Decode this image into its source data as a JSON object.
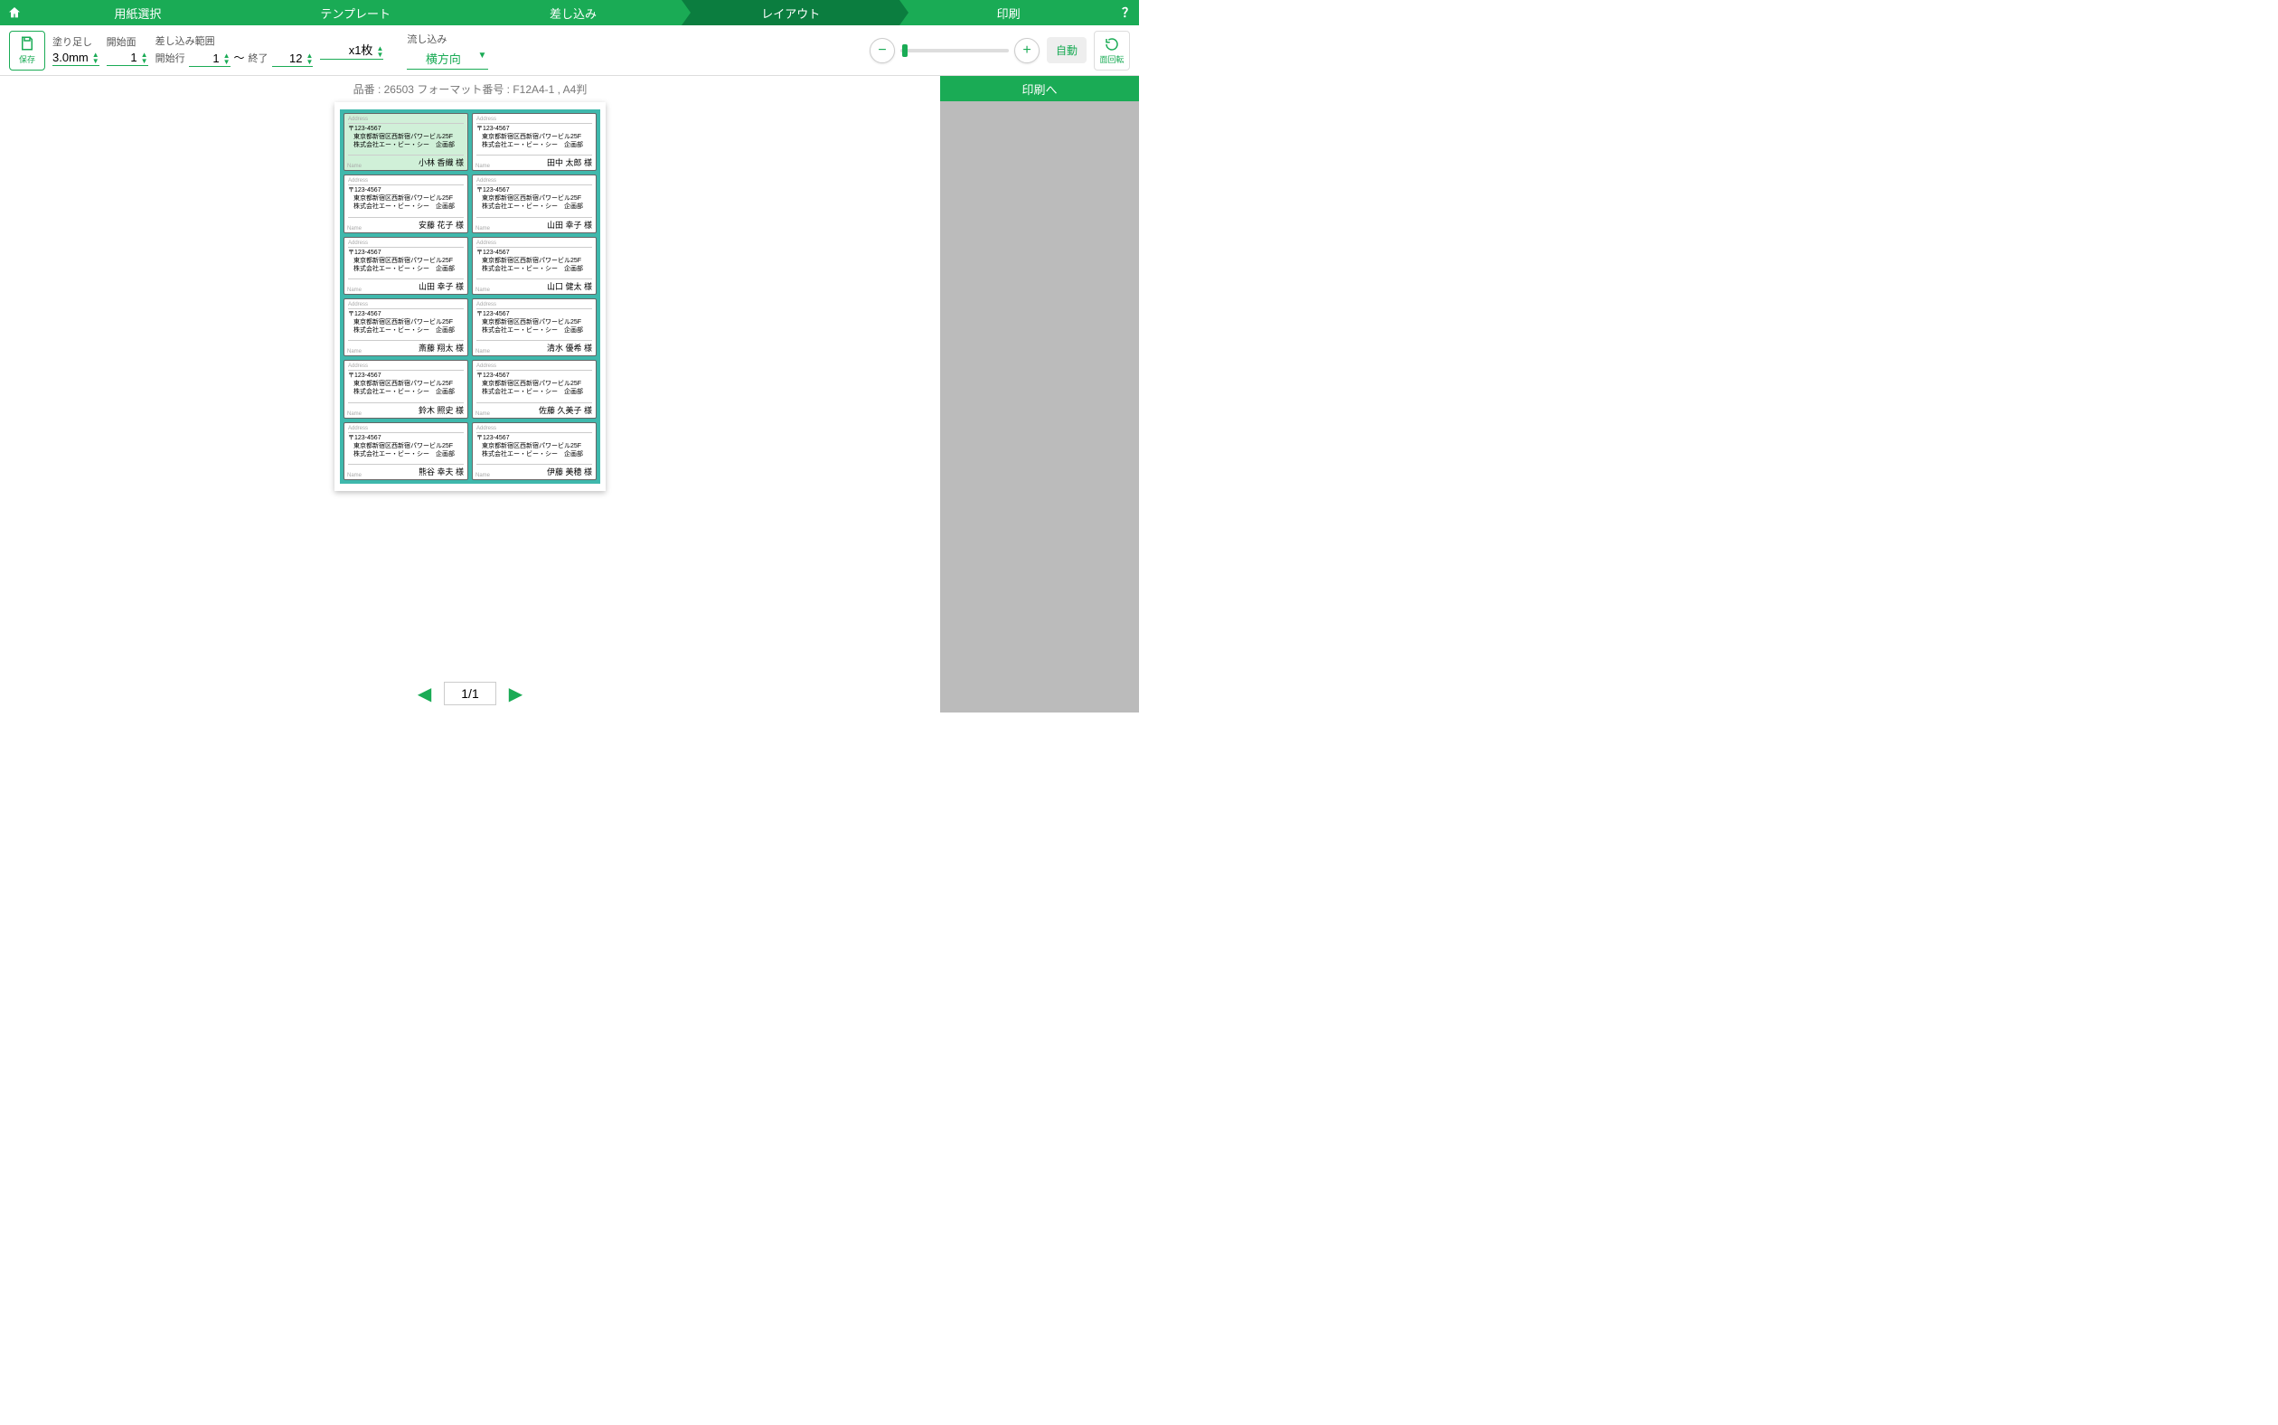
{
  "nav": {
    "steps": [
      "用紙選択",
      "テンプレート",
      "差し込み",
      "レイアウト",
      "印刷"
    ],
    "activeIndex": 3,
    "help": "？"
  },
  "toolbar": {
    "save_label": "保存",
    "bleed": {
      "label": "塗り足し",
      "value": "3.0mm"
    },
    "start_face": {
      "label": "開始面",
      "value": "1"
    },
    "merge_range": {
      "label": "差し込み範囲",
      "start_label": "開始行",
      "start": "1",
      "tilde": "〜",
      "end_label": "終了",
      "end": "12"
    },
    "copies": {
      "value": "x1枚"
    },
    "flow": {
      "label": "流し込み",
      "value": "横方向"
    },
    "auto": "自動",
    "rotate": "面回転"
  },
  "format_info": "品番 : 26503 フォーマット番号 : F12A4-1 , A4判",
  "common": {
    "zip": "〒123-4567",
    "addr1": "東京都新宿区西新宿パワービル25F",
    "addr2": "株式会社エー・ビー・シー　企画部",
    "addr_hdr": "Address",
    "name_hdr": "Name"
  },
  "labels": [
    {
      "name": "小林 香織 様",
      "selected": true
    },
    {
      "name": "田中 太郎 様"
    },
    {
      "name": "安藤 花子 様"
    },
    {
      "name": "山田 幸子 様"
    },
    {
      "name": "山田 幸子 様"
    },
    {
      "name": "山口 健太 様"
    },
    {
      "name": "斎藤 翔太 様"
    },
    {
      "name": "清水 優希 様"
    },
    {
      "name": "鈴木 照史 様"
    },
    {
      "name": "佐藤 久美子 様"
    },
    {
      "name": "熊谷 幸夫 様"
    },
    {
      "name": "伊藤 美穂 様"
    }
  ],
  "pager": {
    "current": "1/1"
  },
  "right": {
    "print": "印刷へ"
  }
}
